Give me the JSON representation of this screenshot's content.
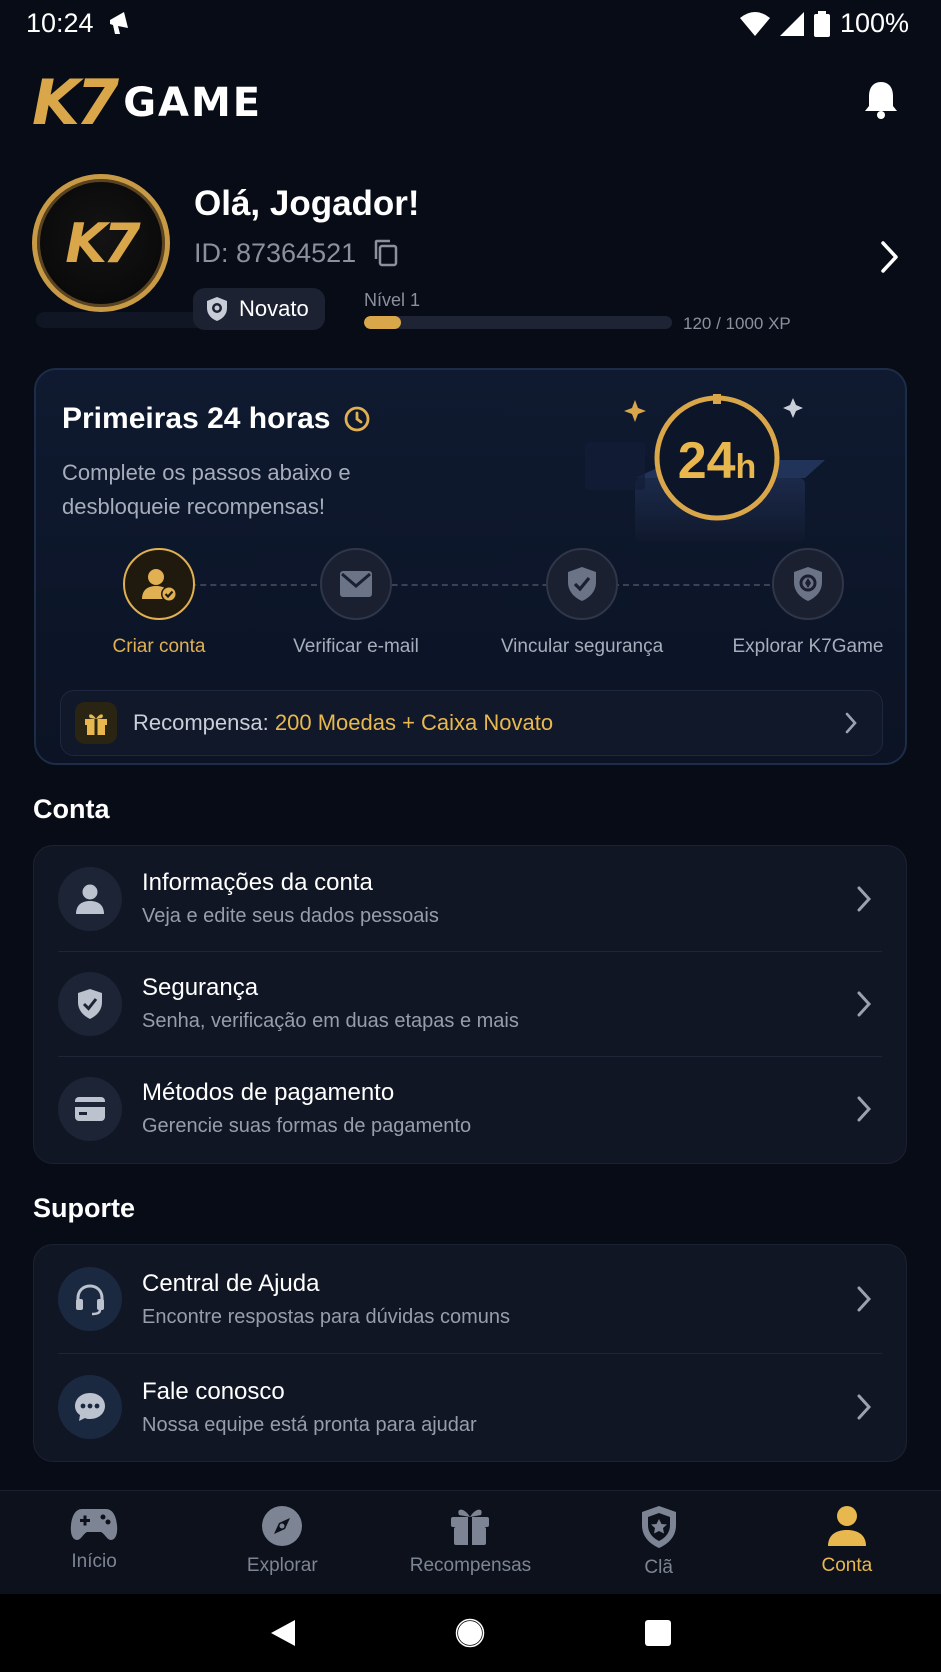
{
  "status": {
    "time": "10:24",
    "battery": "100%"
  },
  "header": {
    "logo_k7": "K7",
    "logo_game": "GAME"
  },
  "profile": {
    "avatar_text": "K7",
    "greeting": "Olá, Jogador!",
    "id_text": "ID: 87364521",
    "badge": "Novato",
    "level": "Nível 1",
    "xp_text": "120 / 1000 XP",
    "xp_progress": 0.12
  },
  "onboarding": {
    "title": "Primeiras 24 horas",
    "description": "Complete os passos abaixo e desbloqueie recompensas!",
    "timer_badge": "24h",
    "steps": [
      {
        "label": "Criar conta",
        "icon": "user-check-icon",
        "active": true
      },
      {
        "label": "Verificar e-mail",
        "icon": "mail-icon",
        "active": false
      },
      {
        "label": "Vincular segurança",
        "icon": "shield-check-icon",
        "active": false
      },
      {
        "label": "Explorar K7Game",
        "icon": "shield-compass-icon",
        "active": false
      }
    ],
    "reward_prefix": "Recompensa:",
    "reward_value": "200 Moedas + Caixa Novato"
  },
  "account": {
    "title": "Conta",
    "items": [
      {
        "title": "Informações da conta",
        "subtitle": "Veja e edite seus dados pessoais",
        "icon": "user-icon"
      },
      {
        "title": "Segurança",
        "subtitle": "Senha, verificação em duas etapas e mais",
        "icon": "shield-icon"
      },
      {
        "title": "Métodos de pagamento",
        "subtitle": "Gerencie suas formas de pagamento",
        "icon": "card-icon"
      }
    ]
  },
  "support": {
    "title": "Suporte",
    "items": [
      {
        "title": "Central de Ajuda",
        "subtitle": "Encontre respostas para dúvidas comuns",
        "icon": "headset-icon"
      },
      {
        "title": "Fale conosco",
        "subtitle": "Nossa equipe está pronta para ajudar",
        "icon": "chat-icon"
      }
    ]
  },
  "bottom_nav": {
    "items": [
      {
        "label": "Início",
        "icon": "gamepad-icon"
      },
      {
        "label": "Explorar",
        "icon": "compass-icon"
      },
      {
        "label": "Recompensas",
        "icon": "gift-icon"
      },
      {
        "label": "Clã",
        "icon": "clan-shield-icon"
      },
      {
        "label": "Conta",
        "icon": "person-icon"
      }
    ],
    "active_index": 4
  },
  "colors": {
    "accent": "#e8b84f",
    "background": "#080c16",
    "card": "#111624"
  }
}
